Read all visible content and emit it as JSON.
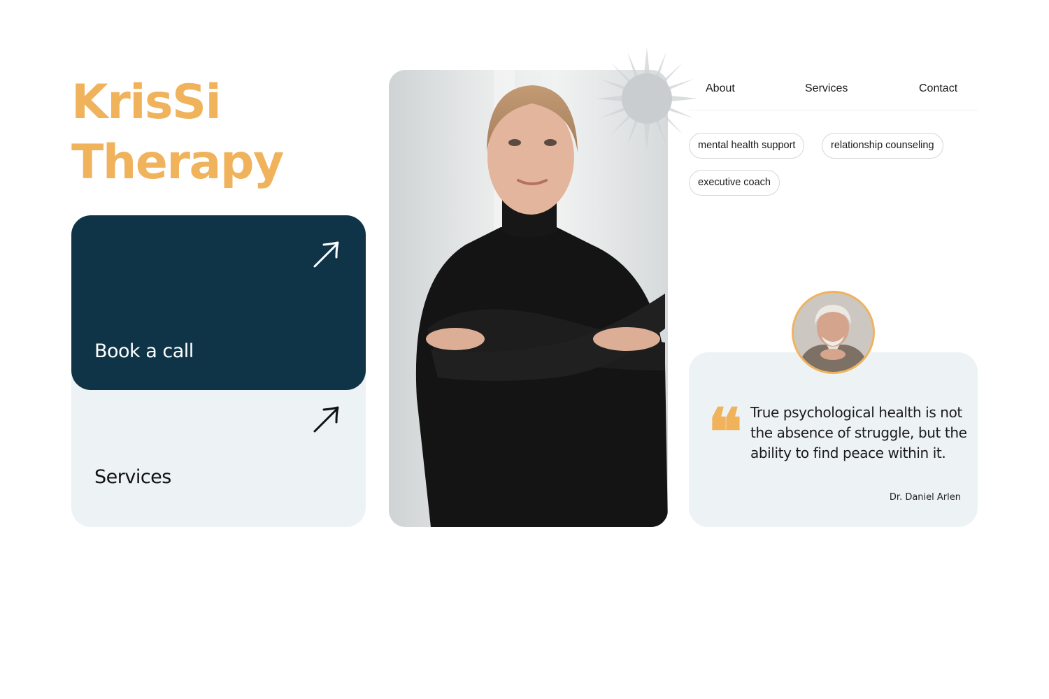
{
  "brand": {
    "line1": "KrisSi",
    "line2": "Therapy"
  },
  "cards": {
    "book": {
      "label": "Book a call",
      "icon": "arrow-up-right-icon"
    },
    "services": {
      "label": "Services",
      "icon": "arrow-up-right-icon"
    }
  },
  "hero": {
    "photo": "portrait of a woman in a black turtleneck with crossed arms"
  },
  "nav": {
    "items": [
      {
        "label": "About"
      },
      {
        "label": "Services"
      },
      {
        "label": "Contact"
      }
    ]
  },
  "tags": [
    {
      "label": "mental health support"
    },
    {
      "label": "relationship counseling"
    },
    {
      "label": "executive coach"
    }
  ],
  "testimonial": {
    "quote_mark": "❝",
    "text": "True psychological health is not the absence of struggle, but the ability to find peace within it.",
    "author": "Dr. Daniel Arlen"
  },
  "colors": {
    "accent": "#f0b35c",
    "dark_card": "#0f3448",
    "light_card": "#edf2f5"
  }
}
